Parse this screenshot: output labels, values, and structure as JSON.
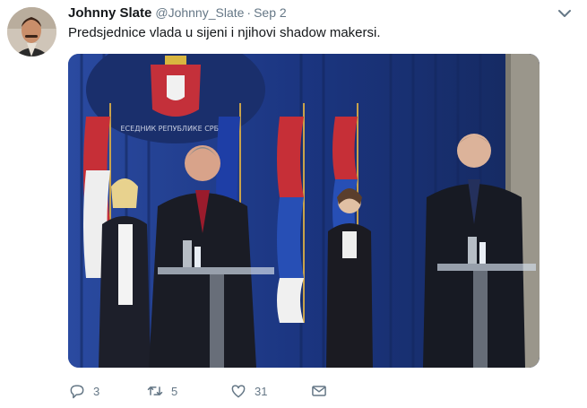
{
  "tweet": {
    "display_name": "Johnny Slate",
    "handle": "@Johnny_Slate",
    "separator": "·",
    "date": "Sep 2",
    "text": "Predsjednice vlada u sijeni i njihovi shadow makersi.",
    "media": {
      "backdrop_text": "ЕСЕДНИК РЕПУБЛИКЕ СРБИЈЕ"
    }
  },
  "actions": {
    "reply": {
      "icon": "reply-icon",
      "count": "3"
    },
    "retweet": {
      "icon": "retweet-icon",
      "count": "5"
    },
    "like": {
      "icon": "like-icon",
      "count": "31"
    },
    "dm": {
      "icon": "direct-message-icon"
    }
  },
  "menu": {
    "icon": "chevron-down-icon"
  },
  "colors": {
    "text_primary": "#14171a",
    "text_secondary": "#657786",
    "curtain_blue": "#1f3b86"
  }
}
